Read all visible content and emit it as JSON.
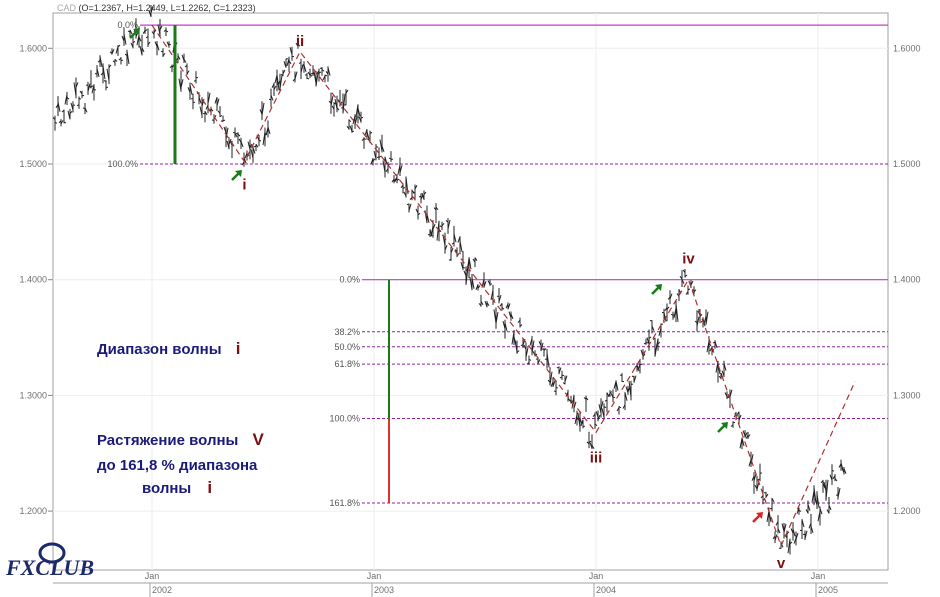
{
  "header": {
    "symbol": "CAD",
    "ohlc": "(O=1.2367, H=1.2449, L=1.2262, C=1.2323)"
  },
  "logo": {
    "text": "FXCLUB"
  },
  "colors": {
    "fib_line": "#c040c0",
    "fib_dash": "#9020a0",
    "wave_path": "#b03030",
    "range_bar": "#1a7a1a",
    "ext_bar": "#e03030",
    "arrow_up": "#1a7a1a",
    "arrow_red": "#e02020"
  },
  "chart_data": {
    "type": "ohlc-bar",
    "y_ticks": [
      "1.6000",
      "1.5000",
      "1.4000",
      "1.3000",
      "1.2000"
    ],
    "ylim": [
      1.125,
      1.645
    ],
    "x_month_labels": [
      "Jan",
      "Jan",
      "Jan",
      "Jan"
    ],
    "x_year_labels": [
      "2002",
      "2003",
      "2004",
      "2005"
    ],
    "fib_top": {
      "levels": [
        {
          "label": "0.0%",
          "value": 1.62
        },
        {
          "label": "100.0%",
          "value": 1.5
        }
      ]
    },
    "fib_bottom": {
      "levels": [
        {
          "label": "0.0%",
          "value": 1.4
        },
        {
          "label": "38.2%",
          "value": 1.355
        },
        {
          "label": "50.0%",
          "value": 1.342
        },
        {
          "label": "61.8%",
          "value": 1.327
        },
        {
          "label": "100.0%",
          "value": 1.28
        },
        {
          "label": "161.8%",
          "value": 1.207
        }
      ]
    },
    "wave_points": [
      {
        "label": "",
        "date": "2002-01",
        "price": 1.62
      },
      {
        "label": "i",
        "date": "2002-06",
        "price": 1.502
      },
      {
        "label": "ii",
        "date": "2002-09",
        "price": 1.597
      },
      {
        "label": "iii",
        "date": "2004-01",
        "price": 1.268
      },
      {
        "label": "iv",
        "date": "2004-06",
        "price": 1.4
      },
      {
        "label": "v",
        "date": "2004-11",
        "price": 1.17
      }
    ],
    "projection": {
      "from_date": "2004-11",
      "from_price": 1.17,
      "to_date": "2005-03",
      "to_price": 1.312
    },
    "annotations": {
      "range": {
        "text": "Диапазон волны",
        "wave": "i"
      },
      "extension": {
        "line1": "Растяжение волны",
        "wave1": "V",
        "line2": "до 161,8 % диапазона",
        "line3": "волны",
        "wave2": "i"
      }
    }
  }
}
